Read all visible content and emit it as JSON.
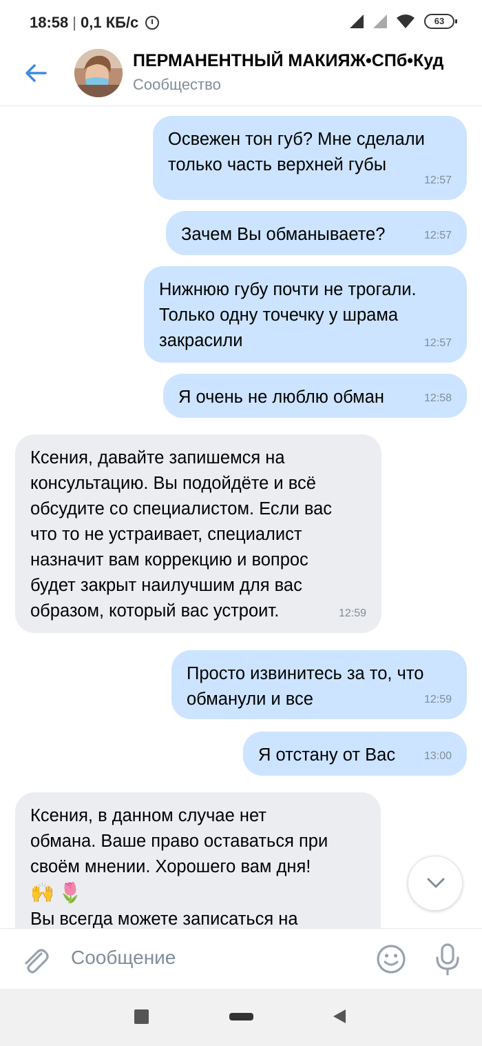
{
  "status_bar": {
    "time": "18:58",
    "speed": "0,1 КБ/с",
    "battery": "63"
  },
  "header": {
    "title": "ПЕРМАНЕНТНЫЙ МАКИЯЖ•СПб•Куд",
    "subtitle": "Сообщество"
  },
  "messages": [
    {
      "dir": "out",
      "text": "Освежен тон губ? Мне сделали\nтолько часть верхней губы",
      "time": "12:57"
    },
    {
      "dir": "out",
      "text": "Зачем Вы обманываете?",
      "time": "12:57"
    },
    {
      "dir": "out",
      "text": "Нижнюю губу почти не трогали.\nТолько одну точечку у шрама\nзакрасили",
      "time": "12:57"
    },
    {
      "dir": "out",
      "text": "Я очень не люблю обман",
      "time": "12:58"
    },
    {
      "dir": "in",
      "text": "Ксения, давайте запишемся на\nконсультацию. Вы подойдёте и всё\nобсудите со специалистом. Если вас\nчто то не устраивает, специалист\nназначит вам коррекцию и вопрос\nбудет закрыт наилучшим для вас\nобразом, который вас устроит.",
      "time": "12:59"
    },
    {
      "dir": "out",
      "text": "Просто извинитесь за то, что\nобманули и все",
      "time": "12:59"
    },
    {
      "dir": "out",
      "text": "Я отстану от Вас",
      "time": "13:00"
    },
    {
      "dir": "in",
      "text": "Ксения, в данном случае нет\nобмана. Ваше право оставаться при\nсвоём мнении. Хорошего вам дня!",
      "emoji": "🙌🌷",
      "text2": "Вы всегда можете записаться на"
    }
  ],
  "composer": {
    "placeholder": "Сообщение"
  },
  "icons": {
    "back": "arrow-left-icon",
    "attach": "paperclip-icon",
    "smile": "smile-icon",
    "mic": "microphone-icon",
    "scroll": "chevron-down-icon"
  },
  "colors": {
    "accent": "#3f8ae0",
    "outgoing_bubble": "#cce4ff",
    "incoming_bubble": "#ebedf0",
    "secondary_text": "#818c99"
  }
}
